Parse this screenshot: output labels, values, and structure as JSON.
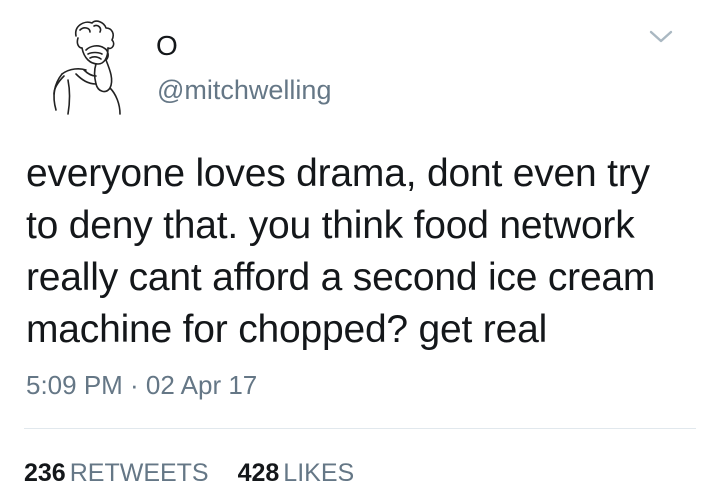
{
  "tweet": {
    "display_name": "O",
    "handle": "@mitchwelling",
    "text_lines": [
      "everyone loves drama, dont even try",
      "to deny that. you think food network",
      "really cant afford a second ice cream",
      "machine for chopped? get real"
    ],
    "timestamp": "5:09 PM · 02 Apr 17",
    "retweets": {
      "count": "236",
      "label": "RETWEETS"
    },
    "likes": {
      "count": "428",
      "label": "LIKES"
    }
  },
  "icons": {
    "avatar": "sketch-person-facepalm-avatar",
    "menu": "chevron-down-icon"
  },
  "colors": {
    "primary_text": "#14171a",
    "secondary_text": "#657786",
    "divider": "#e1e8ed"
  }
}
